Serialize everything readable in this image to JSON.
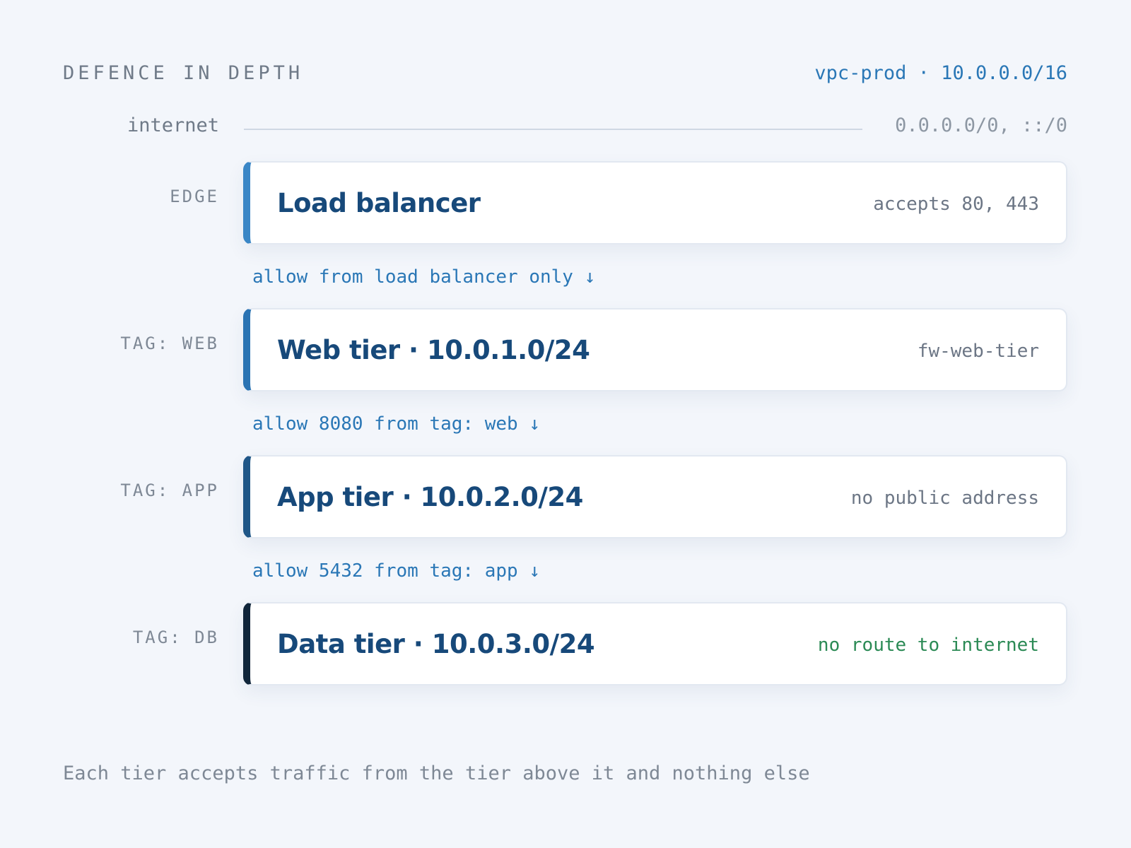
{
  "header": {
    "title": "DEFENCE IN DEPTH",
    "vpc": "vpc-prod · 10.0.0.0/16"
  },
  "internet": {
    "label": "internet",
    "cidr": "0.0.0.0/0, ::/0"
  },
  "tiers": [
    {
      "tag": "EDGE",
      "title": "Load balancer",
      "note": "accepts 80, 443",
      "accent_color": "#3a86c6",
      "note_color": "#6c7685"
    },
    {
      "tag": "TAG: WEB",
      "title": "Web tier · 10.0.1.0/24",
      "note": "fw-web-tier",
      "accent_color": "#2a73b3",
      "note_color": "#6c7685"
    },
    {
      "tag": "TAG: APP",
      "title": "App tier · 10.0.2.0/24",
      "note": "no public address",
      "accent_color": "#1f5687",
      "note_color": "#6c7685"
    },
    {
      "tag": "TAG: DB",
      "title": "Data tier · 10.0.3.0/24",
      "note": "no route to internet",
      "accent_color": "#10253a",
      "note_color": "#2b8a55"
    }
  ],
  "connectors": [
    "allow from load balancer only ↓",
    "allow 8080 from tag: web ↓",
    "allow 5432 from tag: app ↓"
  ],
  "footer": {
    "note": "Each tier accepts traffic from the tier above it and nothing else"
  }
}
